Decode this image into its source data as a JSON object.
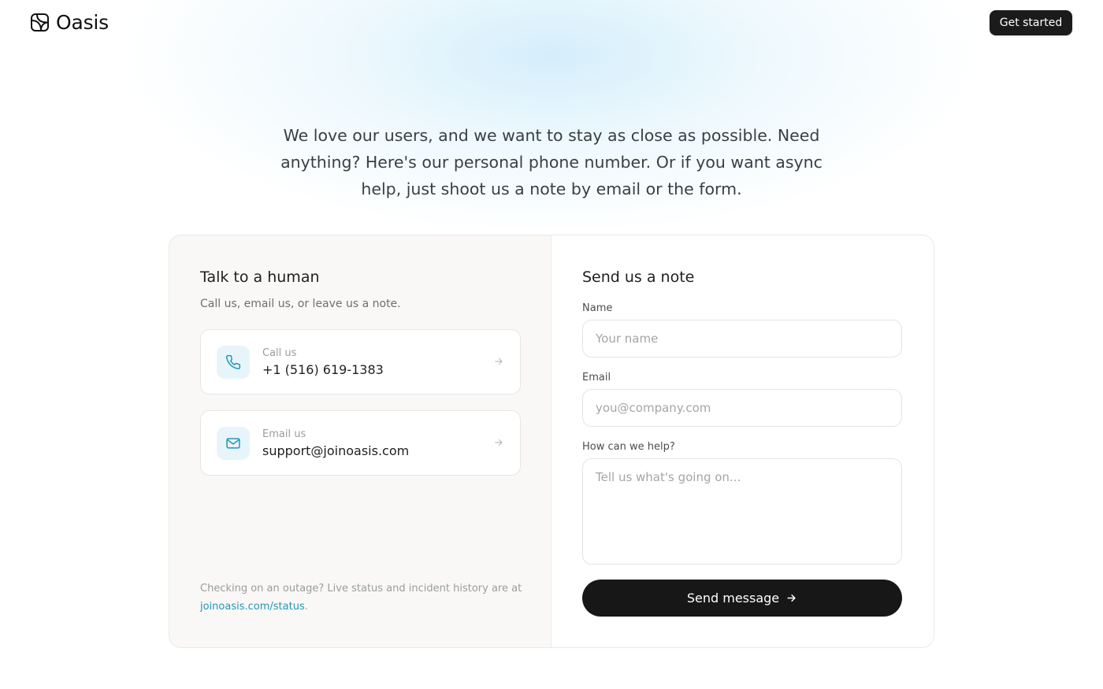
{
  "brand": {
    "name": "Oasis"
  },
  "header": {
    "cta_label": "Get started"
  },
  "intro": {
    "text": "We love our users, and we want to stay as close as possible. Need anything? Here's our personal phone number. Or if you want async help, just shoot us a note by email or the form."
  },
  "left": {
    "title": "Talk to a human",
    "subtitle": "Call us, email us, or leave us a note.",
    "call": {
      "label": "Call us",
      "value": "+1 (516) 619-1383",
      "icon": "phone-icon"
    },
    "email": {
      "label": "Email us",
      "value": "support@joinoasis.com",
      "icon": "mail-icon"
    },
    "status": {
      "text": "Checking on an outage? Live status and incident history are at ",
      "link": "joinoasis.com/status",
      "suffix": "."
    }
  },
  "form": {
    "title": "Send us a note",
    "name_label": "Name",
    "name_placeholder": "Your name",
    "email_label": "Email",
    "email_placeholder": "you@company.com",
    "help_label": "How can we help?",
    "help_placeholder": "Tell us what's going on...",
    "submit_label": "Send message"
  },
  "colors": {
    "accent": "#2596b8",
    "icon_bg": "#e7f5fa",
    "button_dark": "#171717",
    "panel_bg": "#f9f8f6"
  }
}
